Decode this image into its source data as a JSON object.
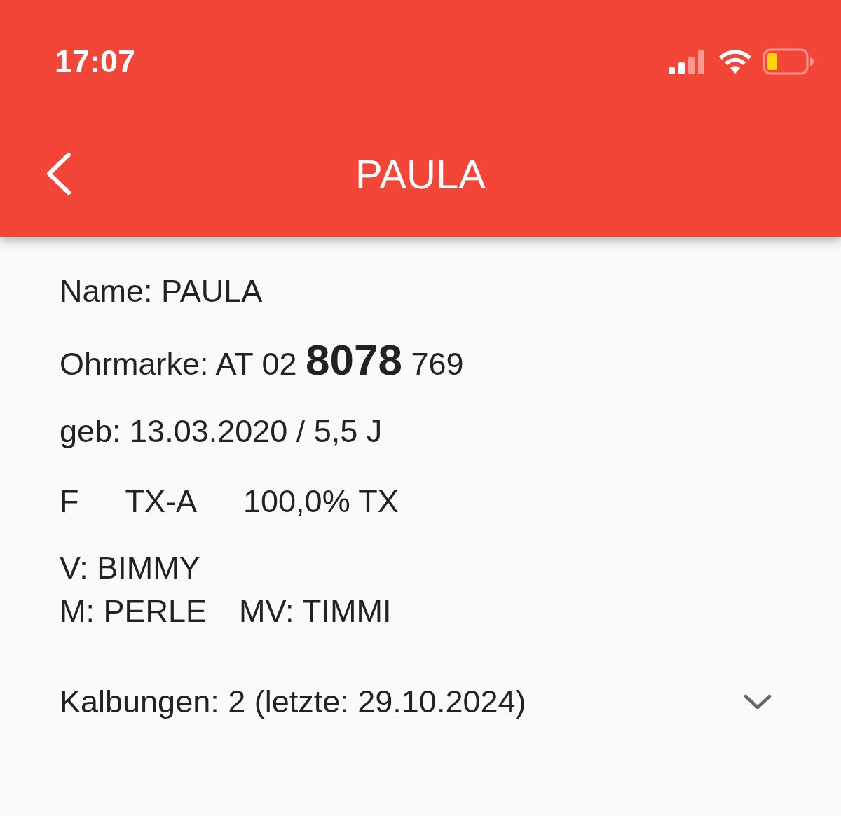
{
  "status_bar": {
    "time": "17:07"
  },
  "header": {
    "title": "PAULA"
  },
  "details": {
    "name": "Name: PAULA",
    "ear_tag": "Ohrmarke: AT 02 **8078** 769",
    "birth": "geb:  13.03.2020 / 5,5 J",
    "attributes": [
      "F",
      "TX-A",
      "100,0% TX"
    ],
    "father": "V: BIMMY",
    "mother": "M: PERLE",
    "mother_father": "MV: TIMMI"
  },
  "calvings": {
    "label": "Kalbungen: 2 (letzte: 29.10.2024)",
    "expanded": false
  }
}
